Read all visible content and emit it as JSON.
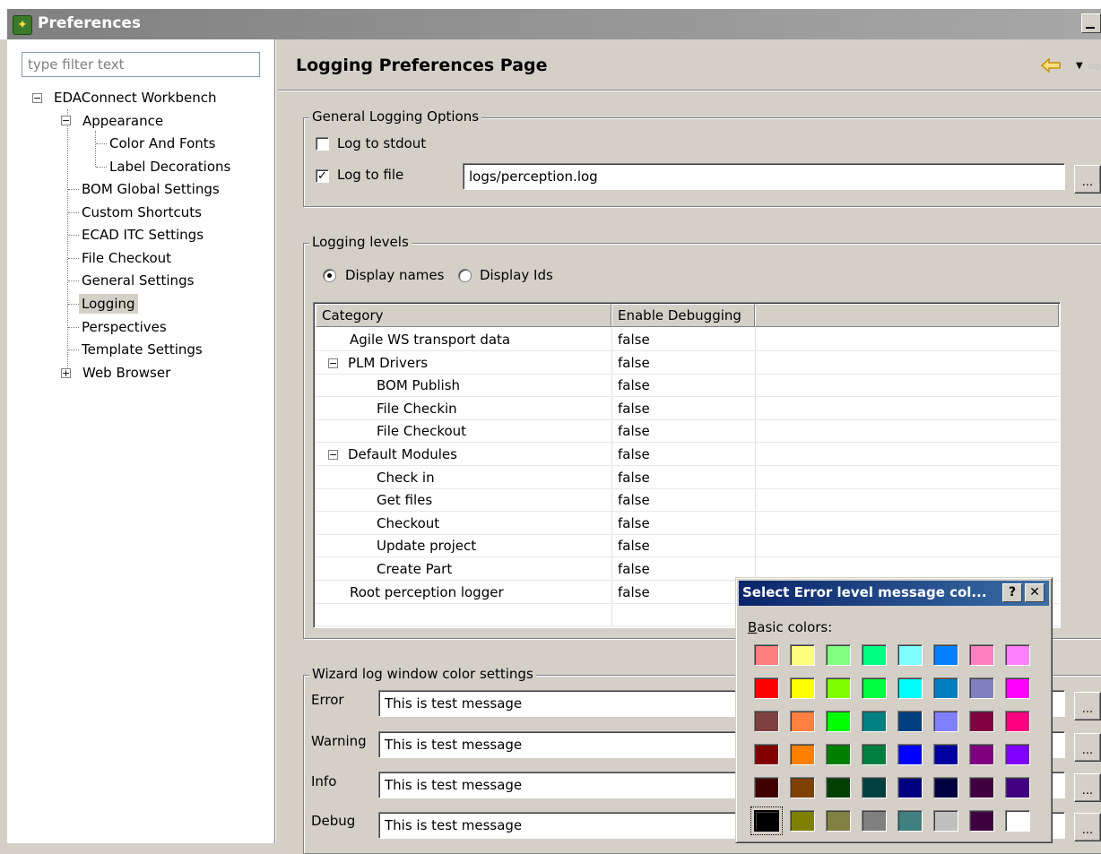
{
  "window": {
    "title": "Preferences"
  },
  "filter": {
    "placeholder": "type filter text"
  },
  "tree": {
    "root": "EDAConnect Workbench",
    "appearance": "Appearance",
    "color_fonts": "Color And Fonts",
    "label_decorations": "Label Decorations",
    "bom": "BOM Global Settings",
    "shortcuts": "Custom Shortcuts",
    "ecad": "ECAD ITC Settings",
    "checkout": "File Checkout",
    "general": "General Settings",
    "logging": "Logging",
    "perspectives": "Perspectives",
    "templates": "Template Settings",
    "web": "Web Browser"
  },
  "page": {
    "title": "Logging Preferences Page"
  },
  "general": {
    "legend": "General Logging Options",
    "stdout_label": "Log to stdout",
    "stdout_checked": false,
    "file_label": "Log to file",
    "file_checked": true,
    "file_path": "logs/perception.log",
    "browse": "..."
  },
  "levels": {
    "legend": "Logging levels",
    "names_label": "Display names",
    "ids_label": "Display Ids",
    "selected": "names",
    "col_category": "Category",
    "col_debug": "Enable Debugging",
    "rows": [
      {
        "name": "Agile WS transport data",
        "value": "false"
      },
      {
        "name": "PLM Drivers",
        "value": "false"
      },
      {
        "name": "BOM Publish",
        "value": "false"
      },
      {
        "name": "File Checkin",
        "value": "false"
      },
      {
        "name": "File Checkout",
        "value": "false"
      },
      {
        "name": "Default Modules",
        "value": "false"
      },
      {
        "name": "Check in",
        "value": "false"
      },
      {
        "name": "Get files",
        "value": "false"
      },
      {
        "name": "Checkout",
        "value": "false"
      },
      {
        "name": "Update project",
        "value": "false"
      },
      {
        "name": "Create Part",
        "value": "false"
      },
      {
        "name": "Root perception logger",
        "value": "false"
      }
    ]
  },
  "wizard": {
    "legend": "Wizard log window color settings",
    "rows": [
      {
        "label": "Error",
        "sample": "This is test message"
      },
      {
        "label": "Warning",
        "sample": "This is test message"
      },
      {
        "label": "Info",
        "sample": "This is test message"
      },
      {
        "label": "Debug",
        "sample": "This is test message"
      }
    ],
    "browse": "..."
  },
  "color_dialog": {
    "title": "Select Error level message col...",
    "help": "?",
    "close": "✕",
    "basic_colors_label": "Basic colors:",
    "colors": [
      [
        "#ff8080",
        "#ffff80",
        "#80ff80",
        "#00ff80",
        "#80ffff",
        "#0080ff",
        "#ff80c0",
        "#ff80ff"
      ],
      [
        "#ff0000",
        "#ffff00",
        "#80ff00",
        "#00ff40",
        "#00ffff",
        "#0080c0",
        "#8080c0",
        "#ff00ff"
      ],
      [
        "#804040",
        "#ff8040",
        "#00ff00",
        "#008080",
        "#004080",
        "#8080ff",
        "#800040",
        "#ff0080"
      ],
      [
        "#800000",
        "#ff8000",
        "#008000",
        "#008040",
        "#0000ff",
        "#0000a0",
        "#800080",
        "#8000ff"
      ],
      [
        "#400000",
        "#804000",
        "#004000",
        "#004040",
        "#000080",
        "#000040",
        "#400040",
        "#400080"
      ],
      [
        "#000000",
        "#808000",
        "#808040",
        "#808080",
        "#408080",
        "#c0c0c0",
        "#400040",
        "#ffffff"
      ]
    ],
    "selected": "#000000"
  }
}
